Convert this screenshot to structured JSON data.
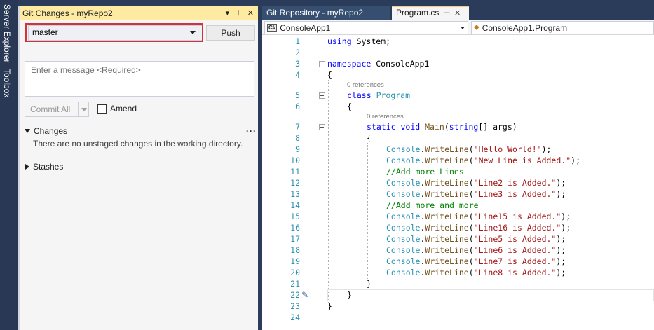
{
  "sidebar": {
    "server_explorer": "Server Explorer",
    "toolbox": "Toolbox"
  },
  "git_changes": {
    "title": "Git Changes - myRepo2",
    "branch": "master",
    "push_label": "Push",
    "message_placeholder": "Enter a message <Required>",
    "commit_all_label": "Commit All",
    "amend_label": "Amend",
    "changes_label": "Changes",
    "changes_empty": "There are no unstaged changes in the working directory.",
    "stashes_label": "Stashes",
    "more_label": "···"
  },
  "tabs": [
    {
      "label": "Git Repository - myRepo2"
    },
    {
      "label": "Program.cs"
    }
  ],
  "navbar": {
    "project": "ConsoleApp1",
    "class": "ConsoleApp1.Program"
  },
  "editor": {
    "line_numbers": [
      "1",
      "2",
      "3",
      "4",
      "5",
      "6",
      "7",
      "8",
      "9",
      "10",
      "11",
      "12",
      "13",
      "14",
      "15",
      "16",
      "17",
      "18",
      "19",
      "20",
      "21",
      "22",
      "23",
      "24"
    ],
    "references_label": "0 references",
    "lines": {
      "l1": "using System;",
      "l3": "namespace ConsoleApp1",
      "l4": "{",
      "l5_kw": "class",
      "l5_name": "Program",
      "l6": "{",
      "l7_kw1": "static",
      "l7_kw2": "void",
      "l7_name": "Main",
      "l7_type": "string",
      "l7_rest": "[] args)",
      "l8": "{",
      "l9": "\"Hello World!\"",
      "l10": "\"New Line is Added.\"",
      "l11": "//Add more Lines",
      "l12": "\"Line2 is Added.\"",
      "l13": "\"Line3 is Added.\"",
      "l14": "//Add more and more",
      "l15": "\"Line15 is Added.\"",
      "l16": "\"Line16 is Added.\"",
      "l17": "\"Line5 is Added.\"",
      "l18": "\"Line6 is Added.\"",
      "l19": "\"Line7 is Added.\"",
      "l20": "\"Line8 is Added.\"",
      "l21": "}",
      "l22": "}",
      "l23": "}",
      "console": "Console",
      "writeline": "WriteLine"
    }
  }
}
